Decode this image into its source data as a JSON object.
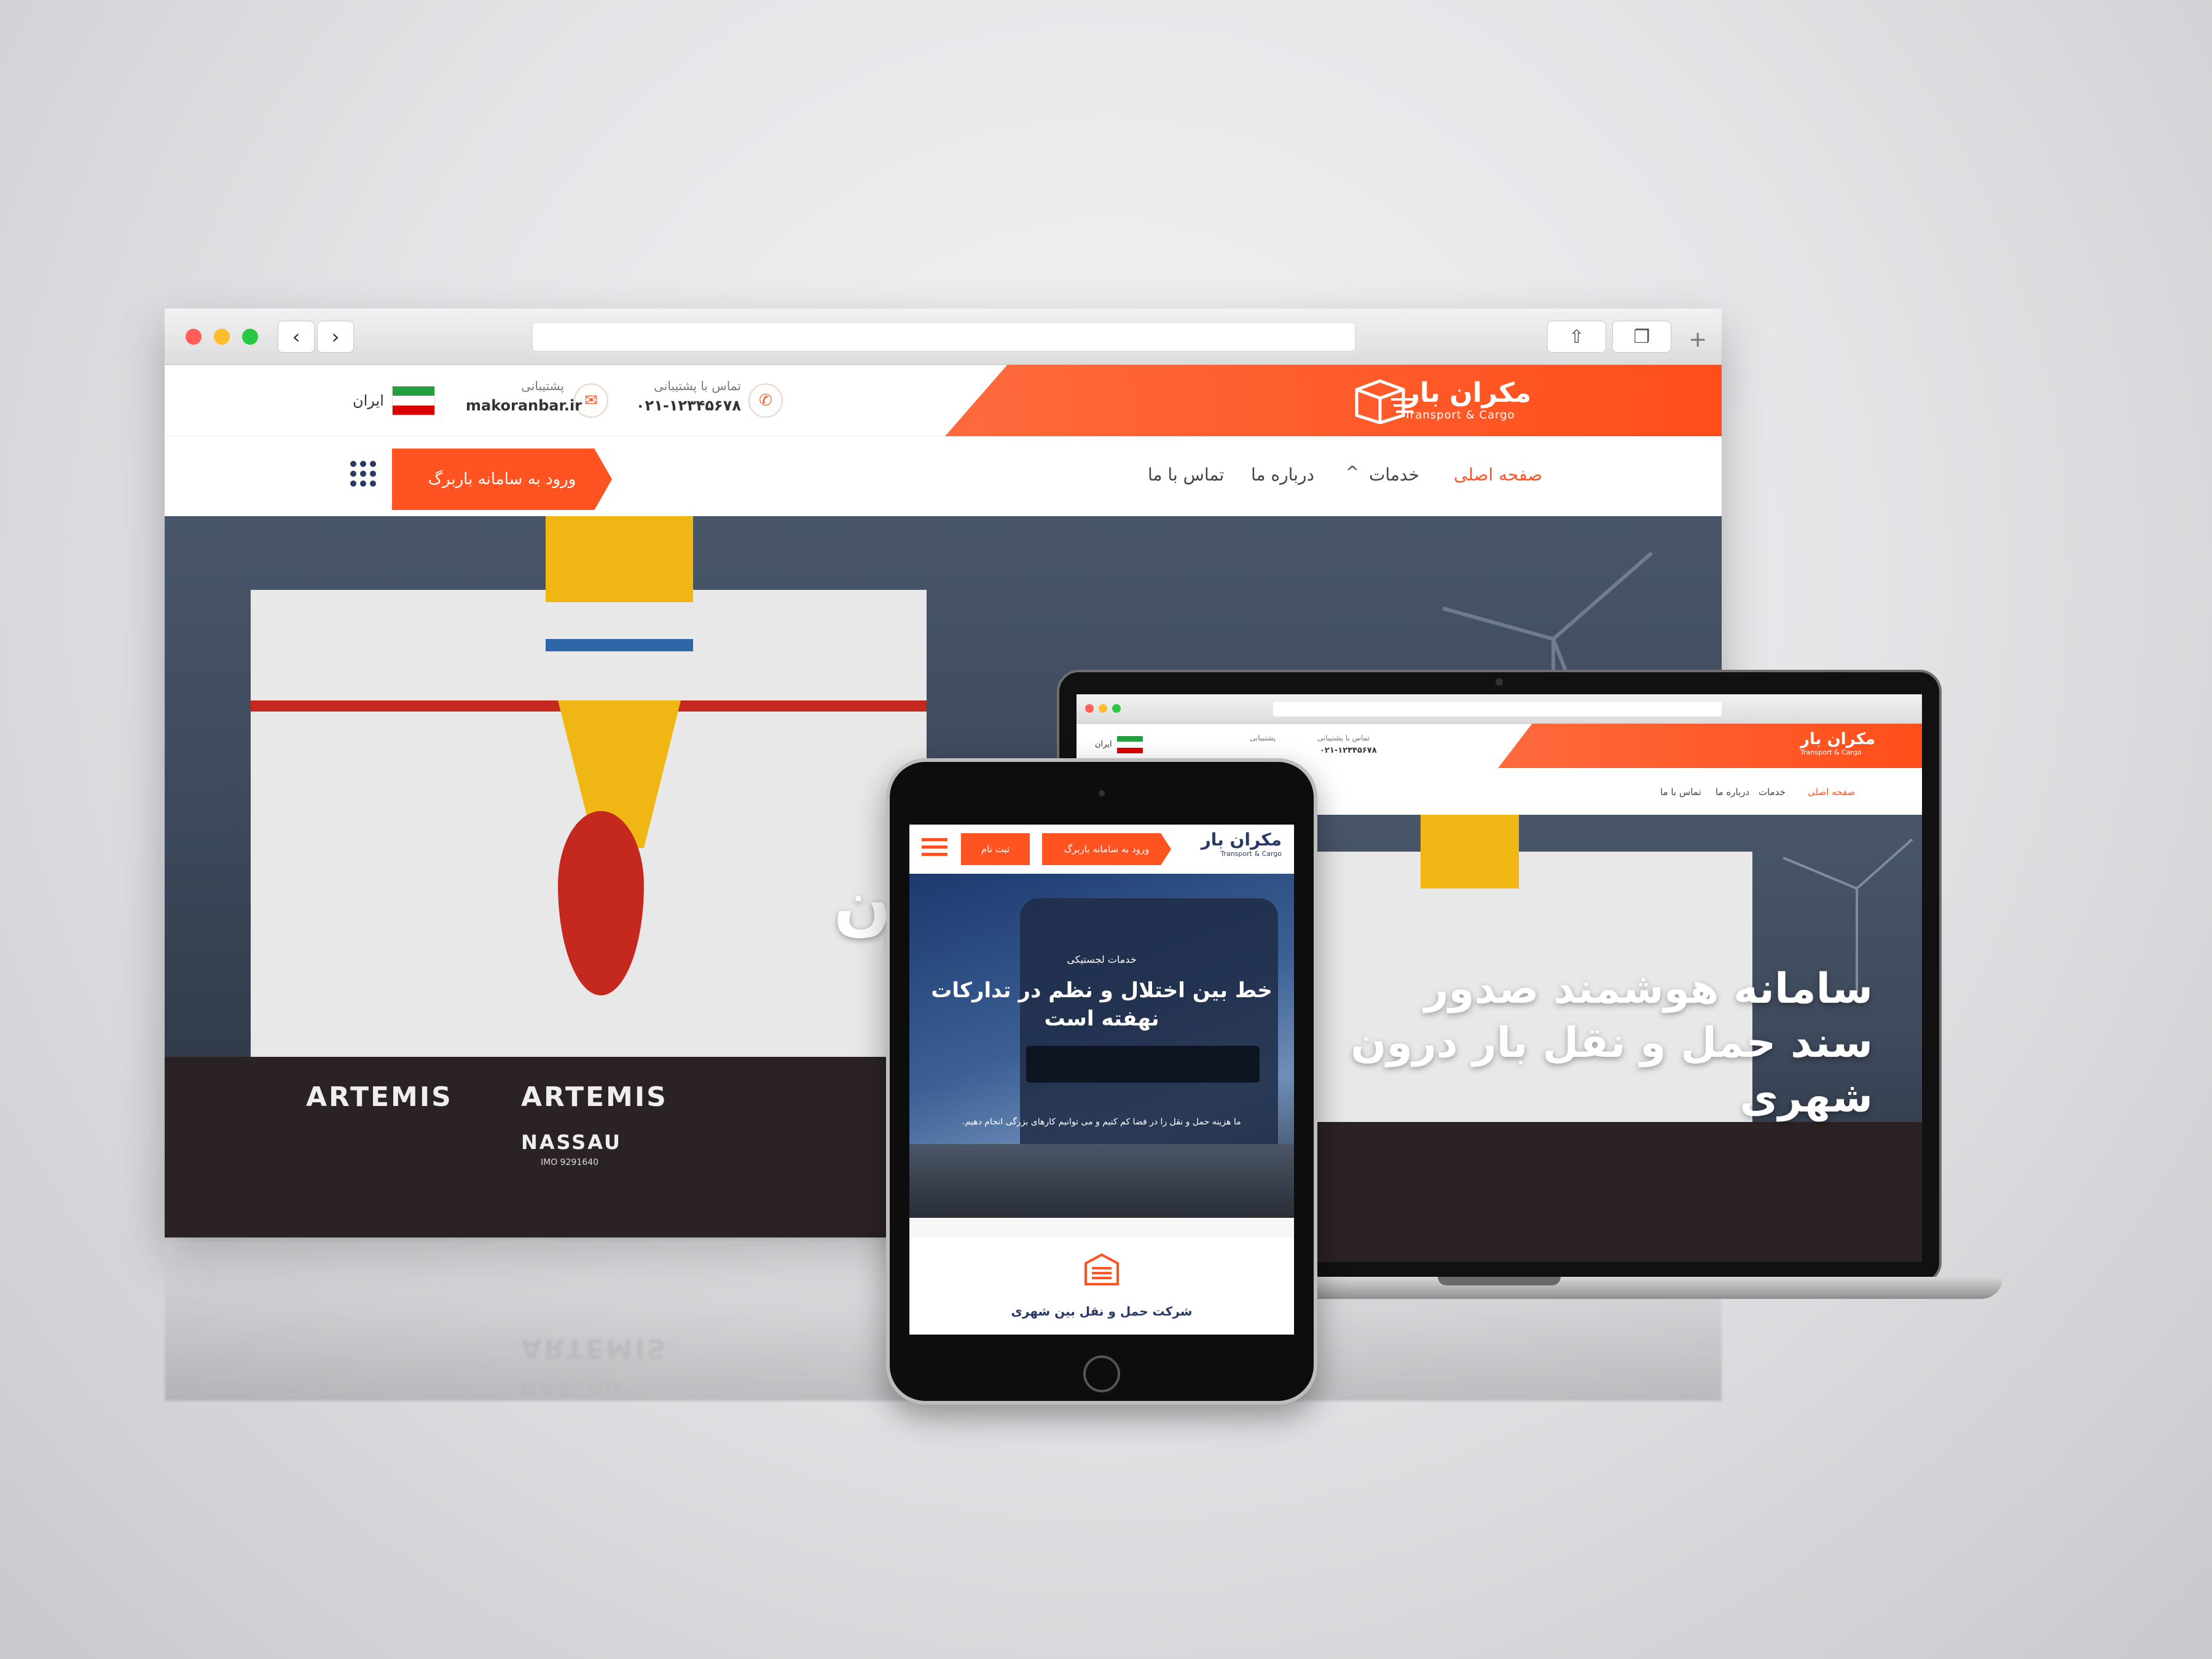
{
  "brand": {
    "name": "مکران بار",
    "tagline": "Transport & Cargo"
  },
  "contact": {
    "phone_label": "تماس با پشتیبانی",
    "phone_value": "۰۲۱-۱۲۳۴۵۶۷۸",
    "email_label": "پشتیبانی",
    "email_value": "makoranbar.ir",
    "country": "ایران"
  },
  "menu": {
    "home": "صفحه اصلی",
    "services": "خدمات",
    "about": "درباره ما",
    "contact": "تماس با ما",
    "login_cta": "ورود به سامانه باربرگ"
  },
  "hero": {
    "line1": "سامانه هوشمند صدور",
    "line2": "سند حمل و نقل بار درون",
    "line3": "شهری",
    "desktop_fragment1": "صدور",
    "desktop_fragment2": "ار درون"
  },
  "ship": {
    "name": "ARTEMIS",
    "port": "NASSAU",
    "imo": "IMO 9291640"
  },
  "tablet": {
    "login_cta": "ورود به سامانه باربرگ",
    "register": "ثبت نام",
    "hero_kicker": "خدمات لجستیکی",
    "hero_title_1": "خط بین اختلال و نظم در تدارکات",
    "hero_title_2": "نهفته است",
    "hero_desc": "ما هزینه حمل و نقل را در فضا کم کنیم و می توانیم کارهای بزرگی انجام دهیم.",
    "service_title": "شرکت حمل و نقل بین شهری"
  },
  "colors": {
    "accent": "#ff5422",
    "navy": "#2a3a66"
  },
  "icons": {
    "phone": "phone-icon",
    "mail": "mail-icon",
    "grid": "grid-menu-icon",
    "hamburger": "hamburger-icon",
    "logo": "cargo-box-icon"
  }
}
